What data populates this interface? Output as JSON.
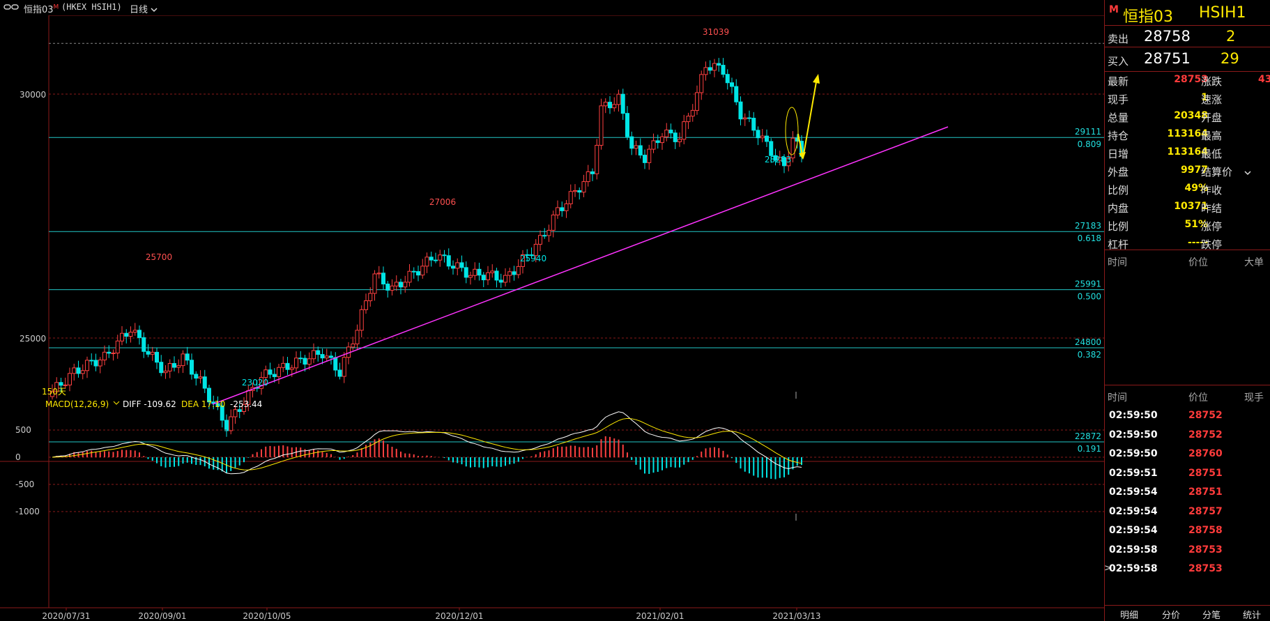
{
  "header": {
    "window_icon": "link-icon",
    "title_main": "恒指03",
    "title_m": "M",
    "title_code": "(HKEX HSIH1)",
    "period": "日线",
    "period_icon": "chevron-down-icon"
  },
  "side": {
    "m_badge": "M",
    "name": "恒指03",
    "code": "HSIH1",
    "sell_label": "卖出",
    "sell_price": "28758",
    "sell_qty": "2",
    "buy_label": "买入",
    "buy_price": "28751",
    "buy_qty": "29",
    "stats": [
      {
        "label": "最新",
        "value": "28753",
        "color": "red",
        "label2": "涨跌",
        "value2": "43"
      },
      {
        "label": "现手",
        "value": "1",
        "color": "yel",
        "label2": "速涨",
        "value2": ""
      },
      {
        "label": "总量",
        "value": "20348",
        "color": "yel",
        "label2": "开盘",
        "value2": ""
      },
      {
        "label": "持仓",
        "value": "113164",
        "color": "yel",
        "label2": "最高",
        "value2": ""
      },
      {
        "label": "日增",
        "value": "113164",
        "color": "yel",
        "label2": "最低",
        "value2": ""
      },
      {
        "label": "外盘",
        "value": "9977",
        "color": "yel",
        "label2": "结算价",
        "value2": ""
      },
      {
        "label": "比例",
        "value": "49%",
        "color": "yel",
        "label2": "昨收",
        "value2": ""
      },
      {
        "label": "内盘",
        "value": "10371",
        "color": "yel",
        "label2": "昨结",
        "value2": ""
      },
      {
        "label": "比例",
        "value": "51%",
        "color": "yel",
        "label2": "涨停",
        "value2": ""
      },
      {
        "label": "杠杆",
        "value": "-----",
        "color": "yel",
        "label2": "跌停",
        "value2": ""
      }
    ],
    "settle_icon": "chevron-down-icon",
    "top_header": {
      "time": "时间",
      "price": "价位",
      "big": "大单"
    },
    "ticks_header": {
      "time": "时间",
      "price": "价位",
      "qty": "现手"
    },
    "ticks": [
      {
        "time": "02:59:50",
        "price": "28752"
      },
      {
        "time": "02:59:50",
        "price": "28752"
      },
      {
        "time": "02:59:50",
        "price": "28760"
      },
      {
        "time": "02:59:51",
        "price": "28751"
      },
      {
        "time": "02:59:54",
        "price": "28751"
      },
      {
        "time": "02:59:54",
        "price": "28757"
      },
      {
        "time": "02:59:54",
        "price": "28758"
      },
      {
        "time": "02:59:58",
        "price": "28753"
      },
      {
        "time": "02:59:58",
        "price": "28753"
      }
    ],
    "tabs": [
      "明细",
      "分价",
      "分笔",
      "统计"
    ]
  },
  "chart_data": {
    "type": "candlestick",
    "title": "",
    "price_axis": {
      "ticks": [
        30000,
        25000
      ],
      "range": [
        22700,
        31700
      ]
    },
    "fib_levels": [
      {
        "price": 29111,
        "ratio": "0.809"
      },
      {
        "price": 27183,
        "ratio": "0.618"
      },
      {
        "price": 25991,
        "ratio": "0.500"
      },
      {
        "price": 24800,
        "ratio": "0.382"
      },
      {
        "price": 22872,
        "ratio": "0.191"
      }
    ],
    "top_line": 31039,
    "annotations": [
      {
        "text": "31039",
        "color": "#ff5050"
      },
      {
        "text": "27006",
        "color": "#ff5050"
      },
      {
        "text": "25700",
        "color": "#ff5050"
      },
      {
        "text": "25940",
        "color": "#00e5e5"
      },
      {
        "text": "23020",
        "color": "#00e5e5"
      },
      {
        "text": "28283",
        "color": "#00e5e5"
      }
    ],
    "ma_label": "150天",
    "macd": {
      "label": "MACD(12,26,9)",
      "diff": "DIFF -109.62",
      "dea": "DEA 17.10",
      "macd": "-253.44",
      "ticks": [
        "500",
        "0",
        "-500",
        "-1000"
      ]
    },
    "x_labels": [
      "2020/07/31",
      "2020/09/01",
      "2020/10/05",
      "2020/12/01",
      "2021/02/01",
      "2021/03/13"
    ]
  }
}
